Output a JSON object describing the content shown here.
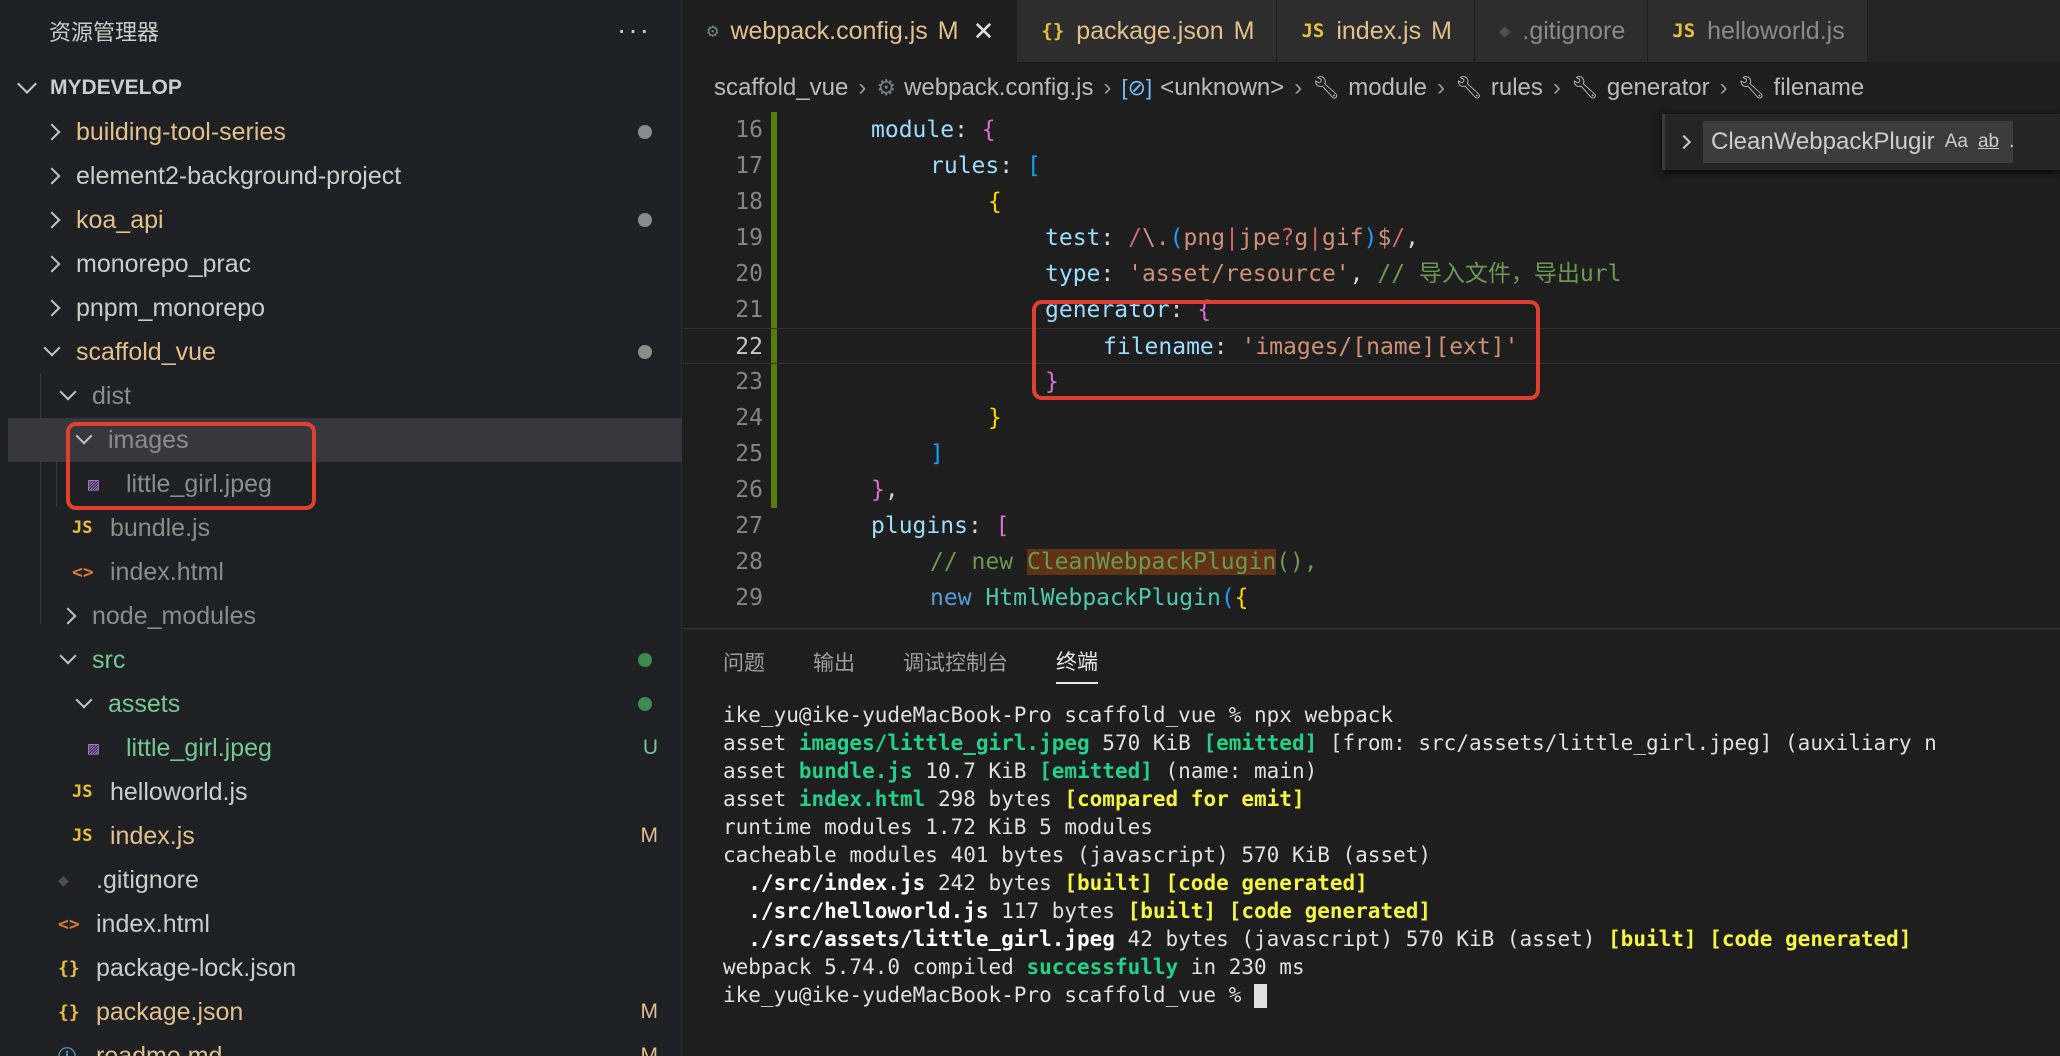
{
  "explorer": {
    "title": "资源管理器",
    "more": "···",
    "section": "MYDEVELOP",
    "items": [
      {
        "label": "building-tool-series",
        "color": "#e2c08d"
      },
      {
        "label": "element2-background-project",
        "color": "#cccccc"
      },
      {
        "label": "koa_api",
        "color": "#e2c08d"
      },
      {
        "label": "monorepo_prac",
        "color": "#cccccc"
      },
      {
        "label": "pnpm_monorepo",
        "color": "#cccccc"
      },
      {
        "label": "scaffold_vue",
        "color": "#e2c08d"
      },
      {
        "label": "dist",
        "color": "#8c8c8c"
      },
      {
        "label": "images",
        "color": "#8c8c8c"
      },
      {
        "label": "little_girl.jpeg",
        "color": "#8c8c8c"
      },
      {
        "label": "bundle.js",
        "color": "#8c8c8c"
      },
      {
        "label": "index.html",
        "color": "#8c8c8c"
      },
      {
        "label": "node_modules",
        "color": "#8c8c8c"
      },
      {
        "label": "src",
        "color": "#73c991"
      },
      {
        "label": "assets",
        "color": "#73c991"
      },
      {
        "label": "little_girl.jpeg",
        "color": "#73c991",
        "badge": "U"
      },
      {
        "label": "helloworld.js",
        "color": "#cccccc"
      },
      {
        "label": "index.js",
        "color": "#e2c08d",
        "badge": "M"
      },
      {
        "label": ".gitignore",
        "color": "#cccccc"
      },
      {
        "label": "index.html",
        "color": "#cccccc"
      },
      {
        "label": "package-lock.json",
        "color": "#cccccc"
      },
      {
        "label": "package.json",
        "color": "#e2c08d",
        "badge": "M"
      },
      {
        "label": "readme.md",
        "color": "#e2c08d",
        "badge": "M"
      }
    ]
  },
  "tabs": [
    {
      "label": "webpack.config.js",
      "mod": "M",
      "icon": "⚙",
      "close": "✕"
    },
    {
      "label": "package.json",
      "mod": "M",
      "icon": "{}"
    },
    {
      "label": "index.js",
      "mod": "M",
      "icon": "JS"
    },
    {
      "label": ".gitignore",
      "mod": "",
      "icon": "◆"
    },
    {
      "label": "helloworld.js",
      "mod": "",
      "icon": "JS"
    }
  ],
  "breadcrumbs": [
    "scaffold_vue",
    "webpack.config.js",
    "<unknown>",
    "module",
    "rules",
    "generator",
    "filename"
  ],
  "find": {
    "value": "CleanWebpackPlugir",
    "opt_case": "Aa",
    "opt_word": "ab",
    "opt_regex": ".*"
  },
  "code": {
    "line_numbers": [
      "16",
      "17",
      "18",
      "19",
      "20",
      "21",
      "22",
      "23",
      "24",
      "25",
      "26",
      "27",
      "28",
      "29"
    ],
    "current_line": "22"
  },
  "panel": {
    "tabs": [
      "问题",
      "输出",
      "调试控制台",
      "终端"
    ],
    "active_tab": "终端",
    "terminal": {
      "prompt": "ike_yu@ike-yudeMacBook-Pro scaffold_vue % ",
      "command": "npx webpack",
      "l2a": "asset ",
      "l2b": "images/little_girl.jpeg",
      "l2c": " 570 KiB ",
      "l2d": "[emitted]",
      "l2e": " [from: src/assets/little_girl.jpeg] (auxiliary n",
      "l3a": "asset ",
      "l3b": "bundle.js",
      "l3c": " 10.7 KiB ",
      "l3d": "[emitted]",
      "l3e": " (name: main)",
      "l4a": "asset ",
      "l4b": "index.html",
      "l4c": " 298 bytes ",
      "l4d": "[compared for emit]",
      "l5": "runtime modules 1.72 KiB 5 modules",
      "l6": "cacheable modules 401 bytes (javascript) 570 KiB (asset)",
      "l7a": "  ./src/index.js",
      "l7b": " 242 bytes ",
      "l7c": "[built] [code generated]",
      "l8a": "  ./src/helloworld.js",
      "l8b": " 117 bytes ",
      "l8c": "[built] [code generated]",
      "l9a": "  ./src/assets/little_girl.jpeg",
      "l9b": " 42 bytes (javascript) 570 KiB (asset) ",
      "l9c": "[built] [code generated]",
      "l10a": "webpack 5.74.0 compiled ",
      "l10b": "successfully",
      "l10c": " in 230 ms"
    }
  }
}
